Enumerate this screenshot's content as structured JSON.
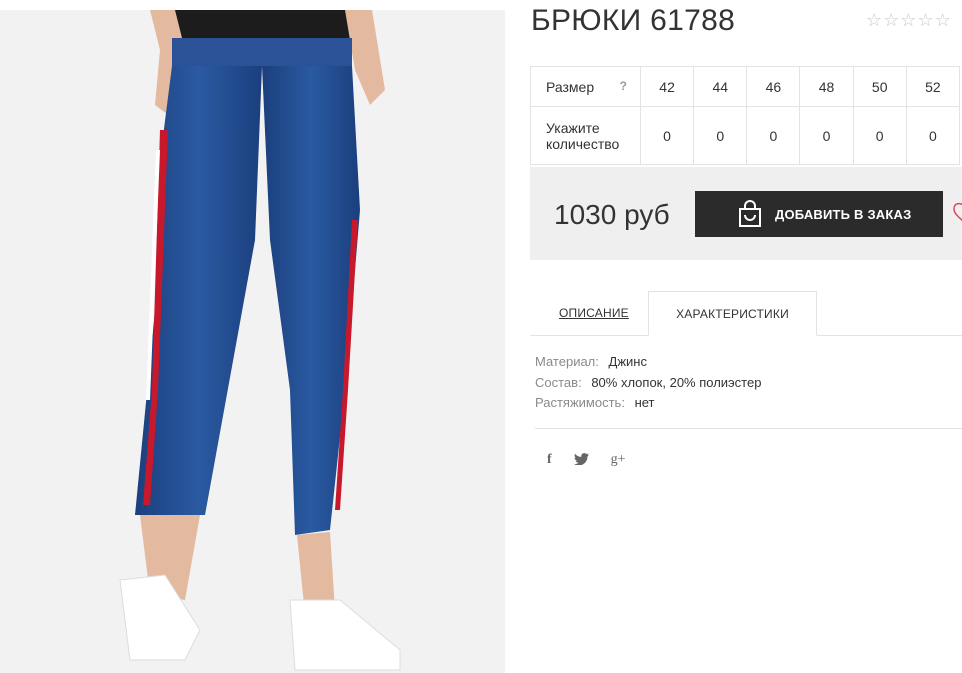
{
  "product": {
    "title": "БРЮКИ 61788",
    "rating_stars": 5,
    "rating_filled": 0
  },
  "sizes": {
    "header_label": "Размер",
    "help_icon": "?",
    "qty_label": "Укажите количество",
    "values": [
      "42",
      "44",
      "46",
      "48",
      "50",
      "52"
    ],
    "quantities": [
      "0",
      "0",
      "0",
      "0",
      "0",
      "0"
    ]
  },
  "order": {
    "price": "1030 руб",
    "add_button_label": "ДОБАВИТЬ В ЗАКАЗ",
    "bag_icon": "shopping-bag-icon",
    "wishlist_icon": "heart-icon"
  },
  "tabs": {
    "description": "ОПИСАНИЕ",
    "characteristics": "ХАРАКТЕРИСТИКИ"
  },
  "characteristics": [
    {
      "key": "Материал:",
      "value": "Джинс"
    },
    {
      "key": "Состав:",
      "value": "80% хлопок, 20% полиэстер"
    },
    {
      "key": "Растяжимость:",
      "value": "нет"
    }
  ],
  "social": {
    "facebook": "f",
    "twitter": "twitter-icon",
    "googleplus": "g+"
  },
  "colors": {
    "button_bg": "#2b2b2b",
    "price_box_bg": "#efefef",
    "denim": "#1f4a8c",
    "stripe_red": "#c8182b"
  }
}
